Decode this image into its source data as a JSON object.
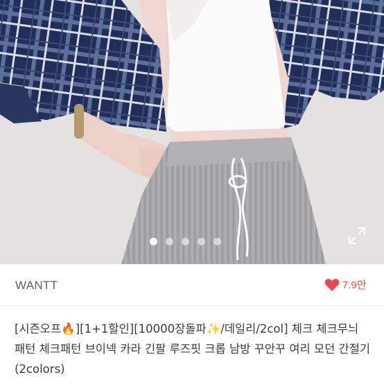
{
  "product": {
    "seller_name": "WANTT",
    "like_count": "7.9만",
    "title": "[시즌오프🔥][1+1할인][10000장돌파✨/데일리/2col] 체크 체크무늬 패턴 체크패턴 브이넥 카라 긴팔 루즈핏 크롭 남방 꾸안꾸 여리 모던 간절기 (2colors)"
  },
  "gallery": {
    "total_images": 5,
    "current_index": 1
  },
  "icons": {
    "like": "heart-icon",
    "expand": "expand-icon"
  },
  "colors": {
    "accent": "#e8484e",
    "plaid_navy": "#1f2f5a",
    "pants_gray": "#a9a9ab"
  }
}
